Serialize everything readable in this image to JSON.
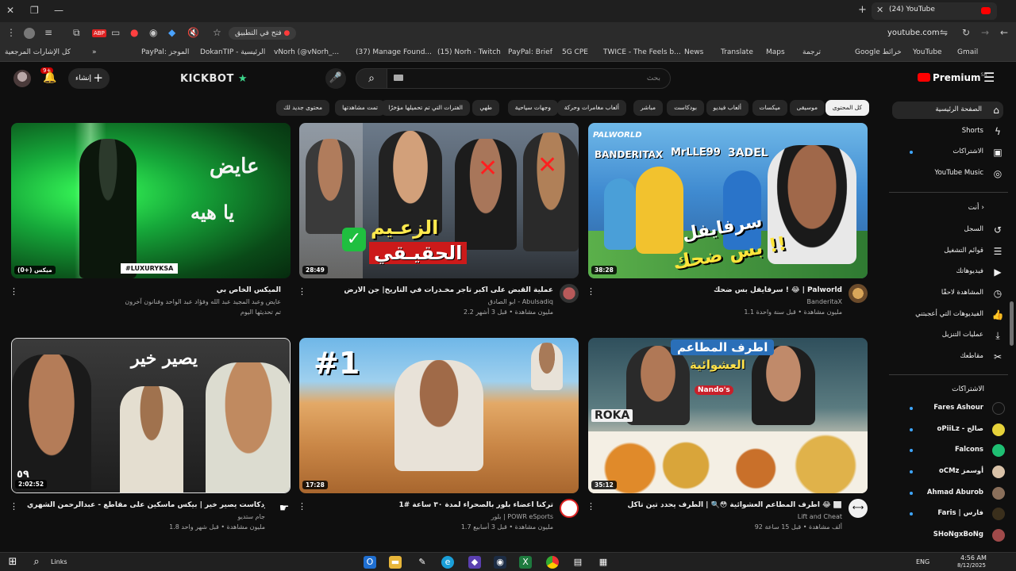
{
  "browser": {
    "tab_title": "(24) YouTube",
    "address": "youtube.com",
    "open_in_app": "فتح في التطبيق",
    "bookmarks": [
      "كل الإشارات المرجعية",
      "PayPal: الموجز",
      "DokanTIP - الرئيسية",
      "vNorh (@vNorh_...",
      "(37) Manage Found...",
      "(15) Norh - Twitch",
      "PayPal: Brief",
      "5G CPE",
      "TWICE - The Feels b...",
      "News",
      "Translate",
      "Maps",
      "ترجمة",
      "Google خرائط",
      "YouTube",
      "Gmail"
    ]
  },
  "header": {
    "create_label": "إنشاء",
    "notification_count": "9+",
    "kickbot_label": "KICKBOT",
    "search_placeholder": "بحث",
    "premium_label": "Premium",
    "premium_region": "SA"
  },
  "chips": [
    "كل المحتوى",
    "موسيقى",
    "ميكسات",
    "ألعاب فيديو",
    "بودكاست",
    "مباشر",
    "ألعاب مغامرات وحركة",
    "وجهات سياحية",
    "طهي",
    "الفترات التي تم تحميلها مؤخرًا",
    "تمت مشاهدتها",
    "محتوى جديد لك"
  ],
  "sidebar": {
    "main": [
      "الصفحة الرئيسية",
      "Shorts",
      "الاشتراكات",
      "YouTube Music"
    ],
    "you_header": "أنت",
    "you": [
      "السجل",
      "قوائم التشغيل",
      "فيديوهاتك",
      "المشاهدة لاحقًا",
      "الفيديوهات التي أعجبتني",
      "عمليات التنزيل",
      "مقاطعك"
    ],
    "subs_header": "الاشتراكات",
    "subscriptions": [
      "Fares Ashour",
      "oPiiLz - صالح",
      "Falcons",
      "oCMz أوسمز",
      "Ahmad Aburob",
      "Faris | فارس",
      "SHoNgxBoNg"
    ]
  },
  "videos": [
    {
      "title": "سرفايفل بس ضحك ! 😂 | Palworld",
      "channel": "BanderitaX",
      "meta": "1.1 مليون مشاهدة • قبل سنة واحدة",
      "duration": "38:28",
      "overlay_main": "سرفايفل",
      "overlay_sub": "بس ضحك !!",
      "overlay_names": [
        "BANDERITAX",
        "MrLLE99",
        "3ADEL"
      ],
      "overlay_brand": "PALWORLD"
    },
    {
      "title": "عملية القبض على اكبر تاجر مخـدرات في التاريخ| جن الارض",
      "channel": "ابو الصادق - Abulsadiq",
      "meta": "2.2 مليون مشاهدة • قبل 3 أشهر",
      "duration": "28:49",
      "overlay_main": "الزعـيم",
      "overlay_sub": "الحقيـقي"
    },
    {
      "title": "الميكس الخاص بي",
      "channel": "عايض وعبد المجيد عبد الله وفؤاد عبد الواحد وفنانون آخرون",
      "meta": "تم تحديثها اليوم",
      "duration": "ميكس (+0)",
      "overlay_main": "عايض",
      "overlay_sub": "يا هيه",
      "overlay_tag": "#LUXURYKSA"
    },
    {
      "title": "اطرف المطاعم العشوائية 😳🔍 | الطرف يحدد تين تأكل 😂 ⬜",
      "channel": "Lift and Cheat",
      "meta": "92 ألف مشاهدة • قبل 15 ساعة",
      "duration": "35:12",
      "overlay_main": "اطرف المطاعم",
      "overlay_sub": "العشوائية",
      "overlay_brand": "ROKA",
      "overlay_brand2": "Nando's"
    },
    {
      "title": "تركنا اعضاء بلور بالصحراء لمدة ٣٠ ساعة #1",
      "channel": "بلور | POWR eSports",
      "meta": "1.7 مليون مشاهدة • قبل 3 أسابيع",
      "duration": "17:28",
      "overlay_main": "#1"
    },
    {
      "title": "بودكاست يصير خير | بيكس ماسكين على مقاطع - عبدالرحمن الشهري",
      "channel": "جام ستديو",
      "meta": "1.8 مليون مشاهدة • قبل شهر واحد",
      "duration": "2:02:52",
      "overlay_main": "يصير خير",
      "overlay_num": "٥٩"
    }
  ],
  "taskbar": {
    "search_label": "Links",
    "time": "4:56 AM",
    "date": "8/12/2025",
    "lang": "ENG"
  },
  "colors": {
    "background": "#0f0f0f",
    "chip": "#272727",
    "accent_red": "#ff0000",
    "green_screen": "#1dbb3c"
  }
}
